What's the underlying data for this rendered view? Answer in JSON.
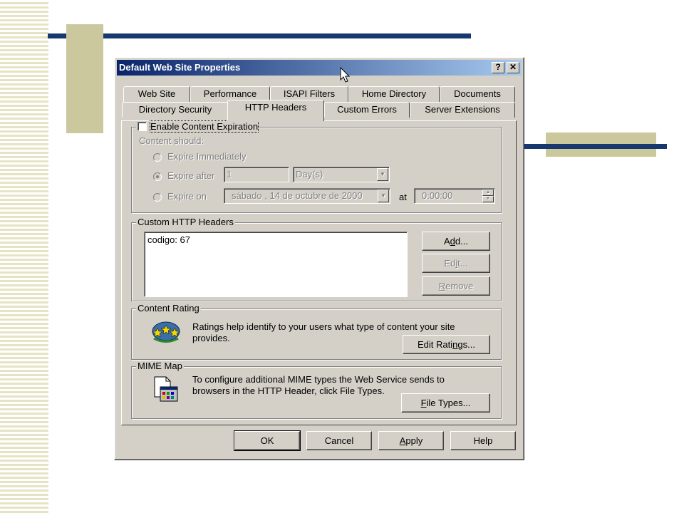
{
  "colors": {
    "slide_navy": "#16386e",
    "slide_khaki": "#cbc89e",
    "titlebar_start": "#0a246a",
    "titlebar_end": "#a6caf0",
    "dialog_face": "#d4d0c8"
  },
  "window": {
    "title": "Default Web Site Properties",
    "help_button": "?",
    "close_button": "✕"
  },
  "tabs": {
    "row1": [
      "Web Site",
      "Performance",
      "ISAPI Filters",
      "Home Directory",
      "Documents"
    ],
    "row2": [
      "Directory Security",
      "HTTP Headers",
      "Custom Errors",
      "Server Extensions"
    ],
    "active": "HTTP Headers"
  },
  "content_expiration": {
    "checkbox_label": "Enable Content Expiration",
    "checked": false,
    "content_should": "Content should:",
    "expire_immediately": "Expire Immediately",
    "expire_after": "Expire after",
    "expire_after_value": "1",
    "expire_after_unit": "Day(s)",
    "expire_on": "Expire on",
    "expire_on_date": "sábado , 14 de octubre de 2000",
    "at_label": "at",
    "time_value": "0:00:00"
  },
  "custom_headers": {
    "group_label": "Custom HTTP Headers",
    "items": [
      "codigo: 67"
    ],
    "add_label": "Add...",
    "edit_label": "Edit...",
    "remove_label": "Remove"
  },
  "content_rating": {
    "group_label": "Content Rating",
    "description": "Ratings help identify to your users what type of content your site provides.",
    "button_label": "Edit Ratings..."
  },
  "mime_map": {
    "group_label": "MIME Map",
    "description": "To configure additional MIME types the Web Service sends to browsers in the HTTP Header, click File Types.",
    "button_label": "File Types..."
  },
  "footer": {
    "ok": "OK",
    "cancel": "Cancel",
    "apply": "Apply",
    "help": "Help"
  }
}
